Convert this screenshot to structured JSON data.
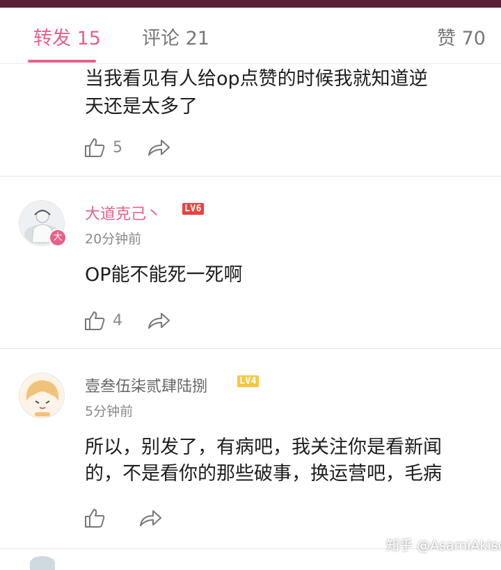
{
  "tabs": [
    {
      "label": "转发 15",
      "active": true
    },
    {
      "label": "评论 21",
      "active": false
    },
    {
      "label": "赞 70",
      "active": false
    }
  ],
  "comments": [
    {
      "text_lines": [
        "当我看见有人给op点赞的时候我就知道逆",
        "天还是太多了"
      ],
      "likes": "5"
    },
    {
      "username": "大道克己丶",
      "level": "LV6",
      "badge": "大",
      "time": "20分钟前",
      "text_lines": [
        "OP能不能死一死啊"
      ],
      "likes": "4"
    },
    {
      "username": "壹叁伍柒贰肆陆捌",
      "level": "LV4",
      "time": "5分钟前",
      "text_lines": [
        "所以，别发了，有病吧，我关注你是看新闻",
        "的，不是看你的那些破事，换运营吧，毛病"
      ],
      "likes": ""
    }
  ],
  "watermark": "知乎 @AsamiAkise",
  "colors": {
    "accent": "#e8608a",
    "topbar": "#5a1f36",
    "lv6": "#f04040",
    "lv4": "#f8c840"
  },
  "icons": [
    "thumbs-up-icon",
    "share-icon"
  ]
}
